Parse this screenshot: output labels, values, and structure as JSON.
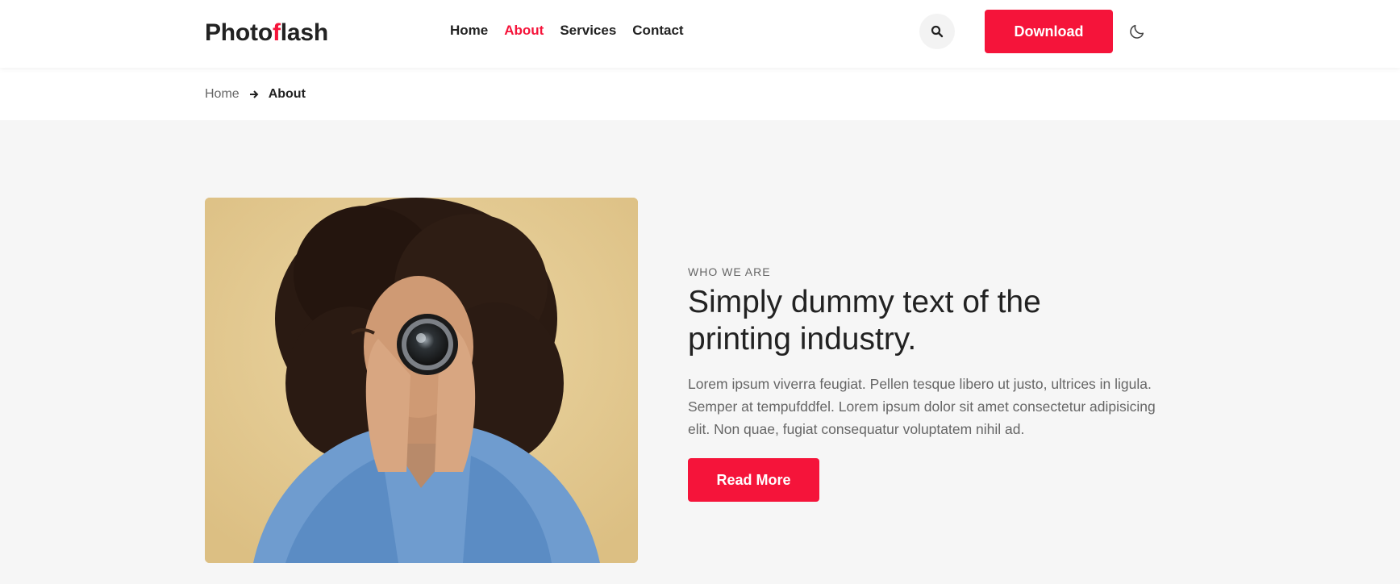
{
  "brand": {
    "logo_prefix": "Photo",
    "logo_accent": "f",
    "logo_suffix": "lash"
  },
  "nav": {
    "items": [
      {
        "label": "Home",
        "active": false
      },
      {
        "label": "About",
        "active": true
      },
      {
        "label": "Services",
        "active": false
      },
      {
        "label": "Contact",
        "active": false
      }
    ]
  },
  "header": {
    "download_label": "Download",
    "search_icon": "search-icon",
    "theme_icon": "moon-icon"
  },
  "breadcrumb": {
    "home": "Home",
    "current": "About",
    "separator_icon": "arrow-right-icon"
  },
  "about": {
    "eyebrow": "WHO WE ARE",
    "headline": "Simply dummy text of the printing industry.",
    "body": "Lorem ipsum viverra feugiat. Pellen tesque libero ut justo, ultrices in ligula. Semper at tempufddfel. Lorem ipsum dolor sit amet consectetur adipisicing elit. Non quae, fugiat consequatur voluptatem nihil ad.",
    "cta_label": "Read More"
  },
  "colors": {
    "accent": "#f5143a",
    "page_bg": "#f6f6f6",
    "text": "#222222",
    "muted": "#666666"
  }
}
